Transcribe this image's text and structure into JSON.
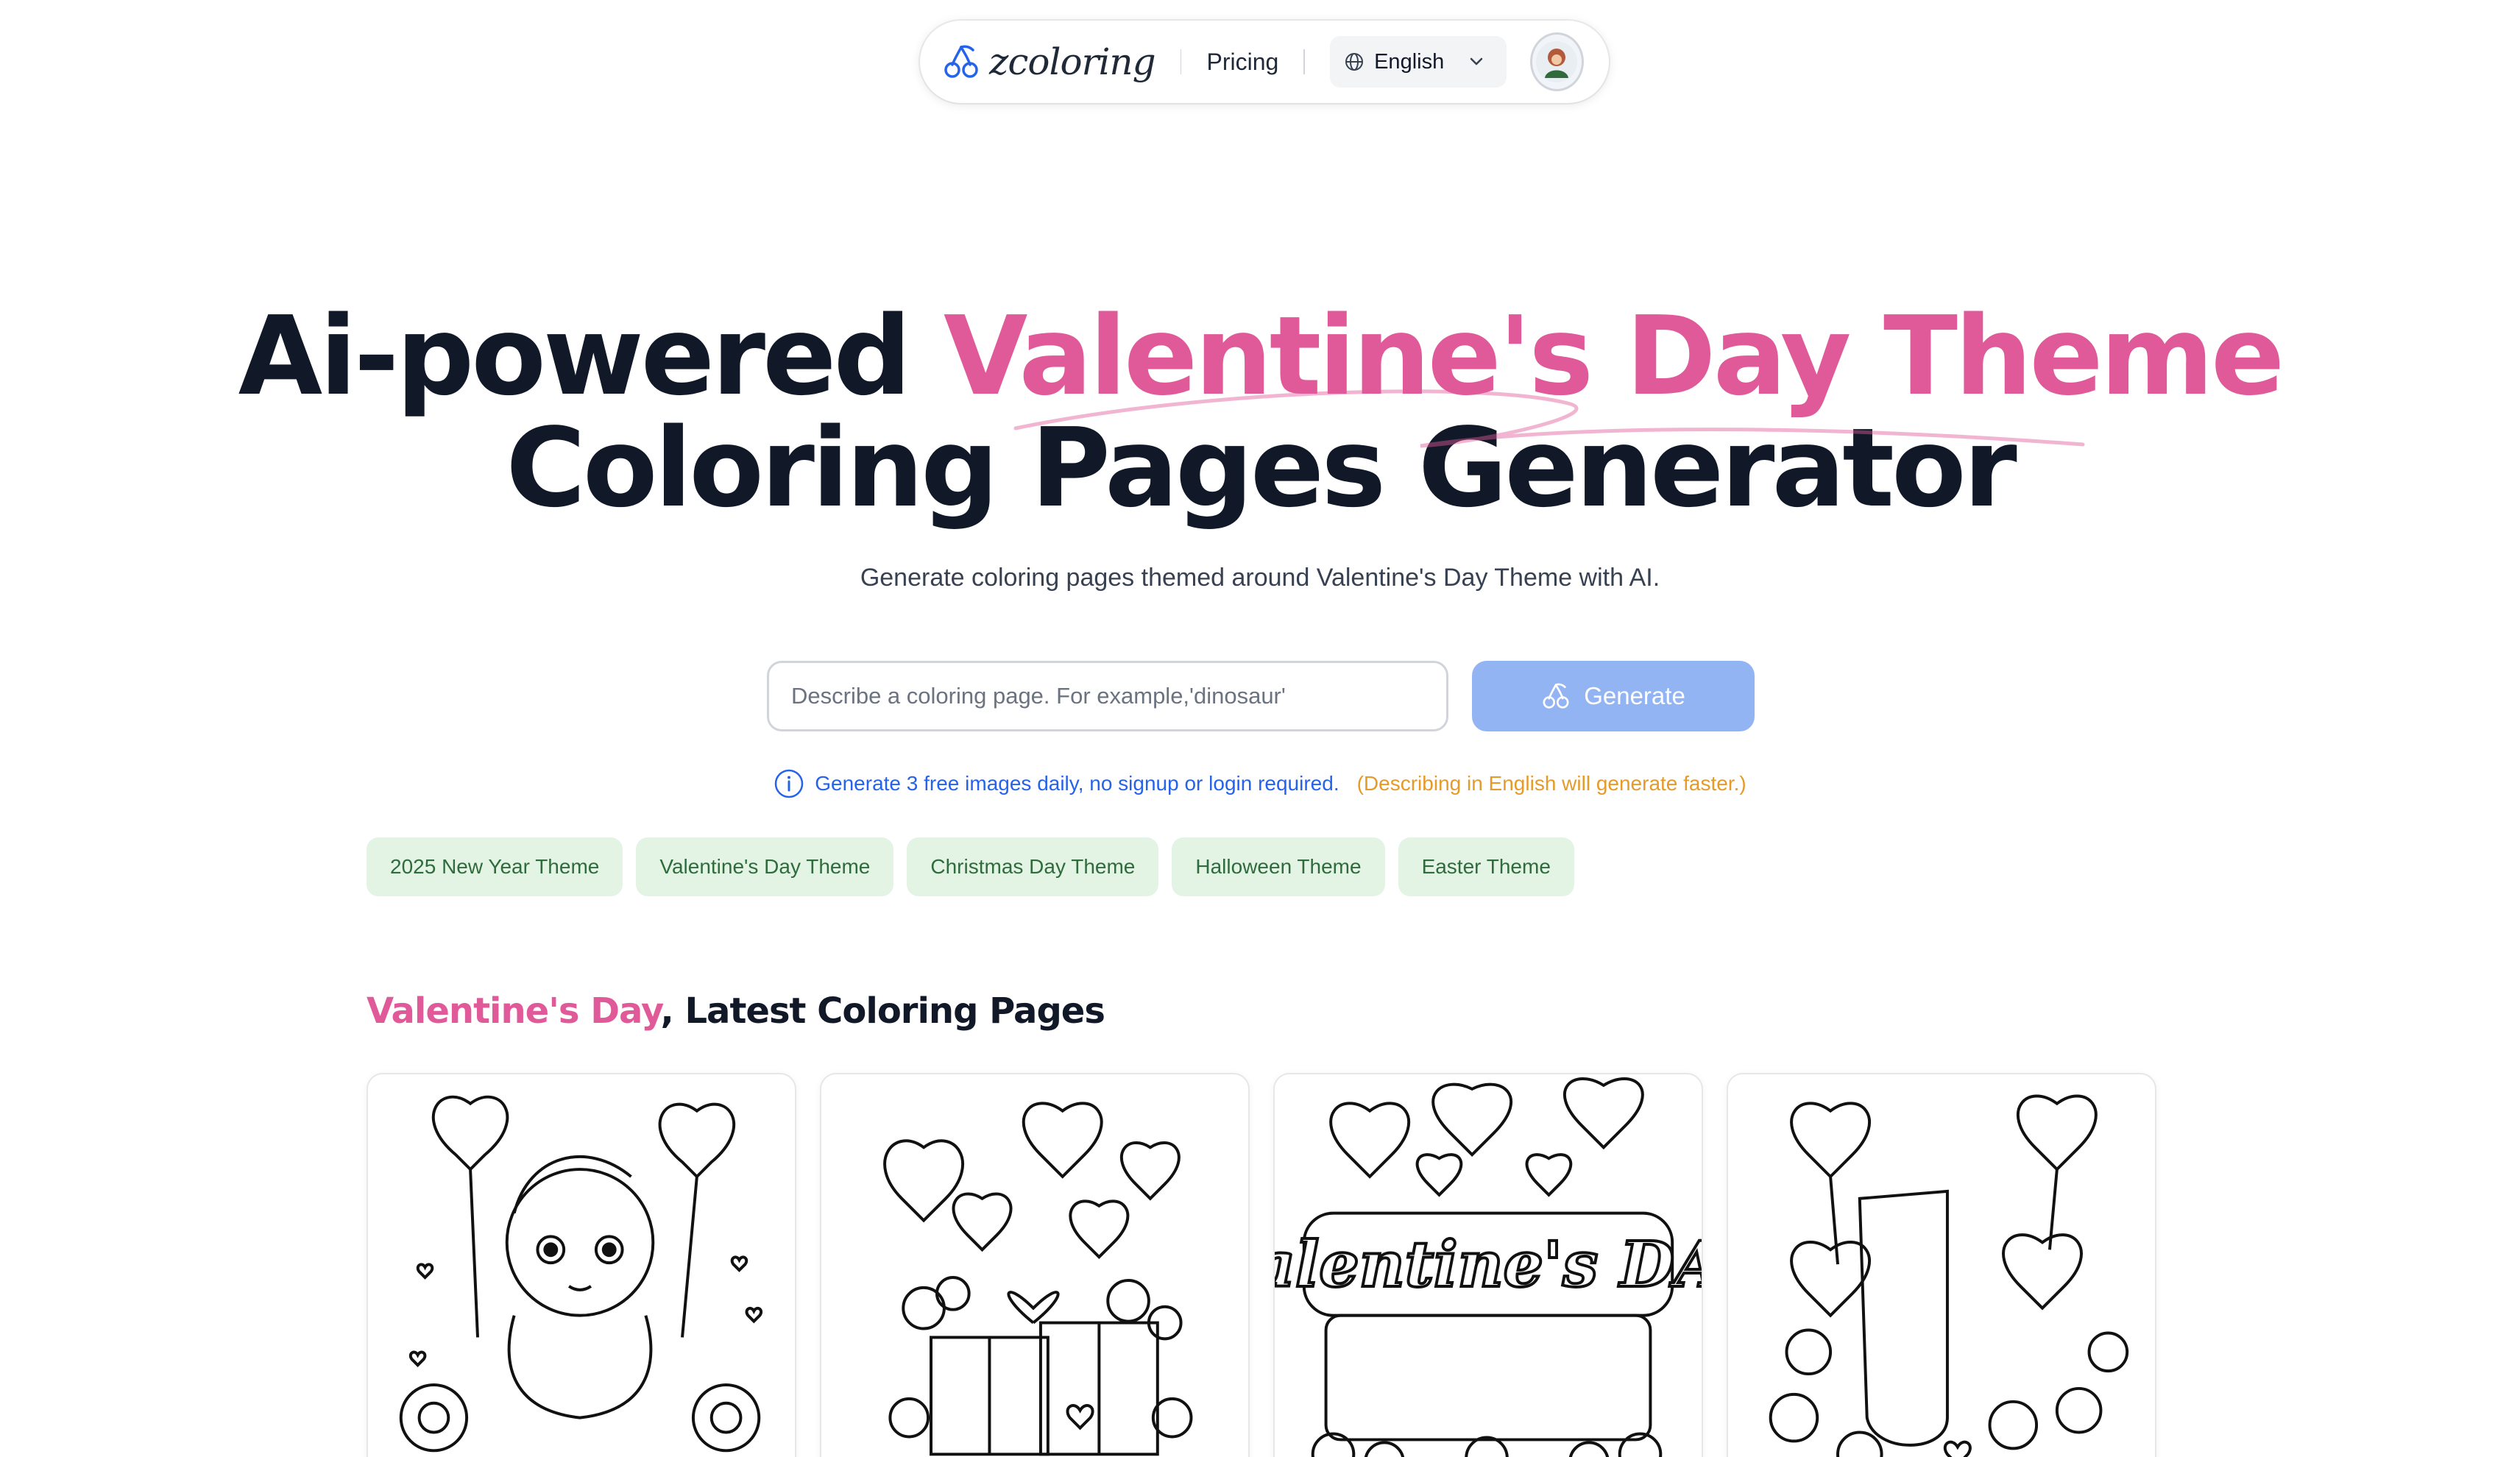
{
  "nav": {
    "brand": "zcoloring",
    "pricing": "Pricing",
    "language": "English"
  },
  "hero": {
    "title_prefix": "Ai-powered",
    "title_accent": "Valentine's Day Theme",
    "title_line2": "Coloring Pages Generator",
    "subtitle": "Generate coloring pages themed around Valentine's Day Theme with AI."
  },
  "search": {
    "placeholder": "Describe a coloring page. For example,'dinosaur'",
    "value": "",
    "button_label": "Generate"
  },
  "notice": {
    "info": "Generate 3 free images daily, no signup or login required.",
    "hint": "(Describing in English will generate faster.)"
  },
  "themes": [
    "2025 New Year Theme",
    "Valentine's Day Theme",
    "Christmas Day Theme",
    "Halloween Theme",
    "Easter Theme"
  ],
  "section": {
    "highlight": "Valentine's Day",
    "rest": ", Latest Coloring Pages"
  },
  "gallery": [
    {
      "text": ""
    },
    {
      "text": ""
    },
    {
      "text": "Valentine's DAY"
    },
    {
      "text": ""
    }
  ],
  "colors": {
    "accent_pink": "#e05a9a",
    "primary_blue": "#2563eb",
    "button_blue": "#93b4f3",
    "chip_bg": "#e3f4e5",
    "chip_text": "#2f6b3d",
    "hint_orange": "#e59a2a"
  },
  "icons": {
    "brand": "cherry-logo-icon",
    "language": "globe-icon",
    "dropdown": "chevron-down-icon",
    "generate": "cherry-icon",
    "notice": "info-icon"
  }
}
